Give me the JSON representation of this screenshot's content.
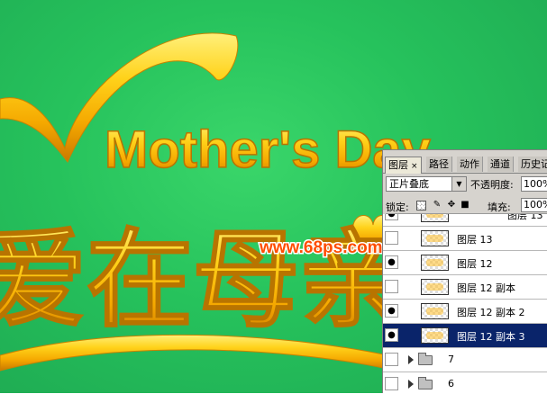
{
  "artwork": {
    "english_title": "Mother's Day",
    "chinese_title": "爱在母亲",
    "watermark": "www.68ps.com",
    "colors": {
      "background": "#26c25c",
      "gold": "#ffc20e",
      "gold_dark": "#d88a00",
      "watermark": "#ff4d00"
    }
  },
  "layers_panel": {
    "tabs": [
      {
        "label": "图层",
        "close": "×",
        "active": true
      },
      {
        "label": "路径"
      },
      {
        "label": "动作"
      },
      {
        "label": "通道"
      },
      {
        "label": "历史记"
      }
    ],
    "blend_mode": "正片叠底",
    "opacity_label": "不透明度:",
    "opacity_value": "100%",
    "lock_label": "锁定:",
    "fill_label": "填充:",
    "fill_value": "100%",
    "layers": [
      {
        "name": "图层 13 ...",
        "visible": true,
        "selected": false
      },
      {
        "name": "图层 13",
        "visible": false,
        "selected": false
      },
      {
        "name": "图层 12",
        "visible": true,
        "selected": false
      },
      {
        "name": "图层 12 副本",
        "visible": false,
        "selected": false
      },
      {
        "name": "图层 12 副本 2",
        "visible": true,
        "selected": false
      },
      {
        "name": "图层 12 副本 3",
        "visible": true,
        "selected": true
      },
      {
        "name": "7",
        "visible": false,
        "group": true
      },
      {
        "name": "6",
        "visible": false,
        "group": true
      }
    ]
  }
}
